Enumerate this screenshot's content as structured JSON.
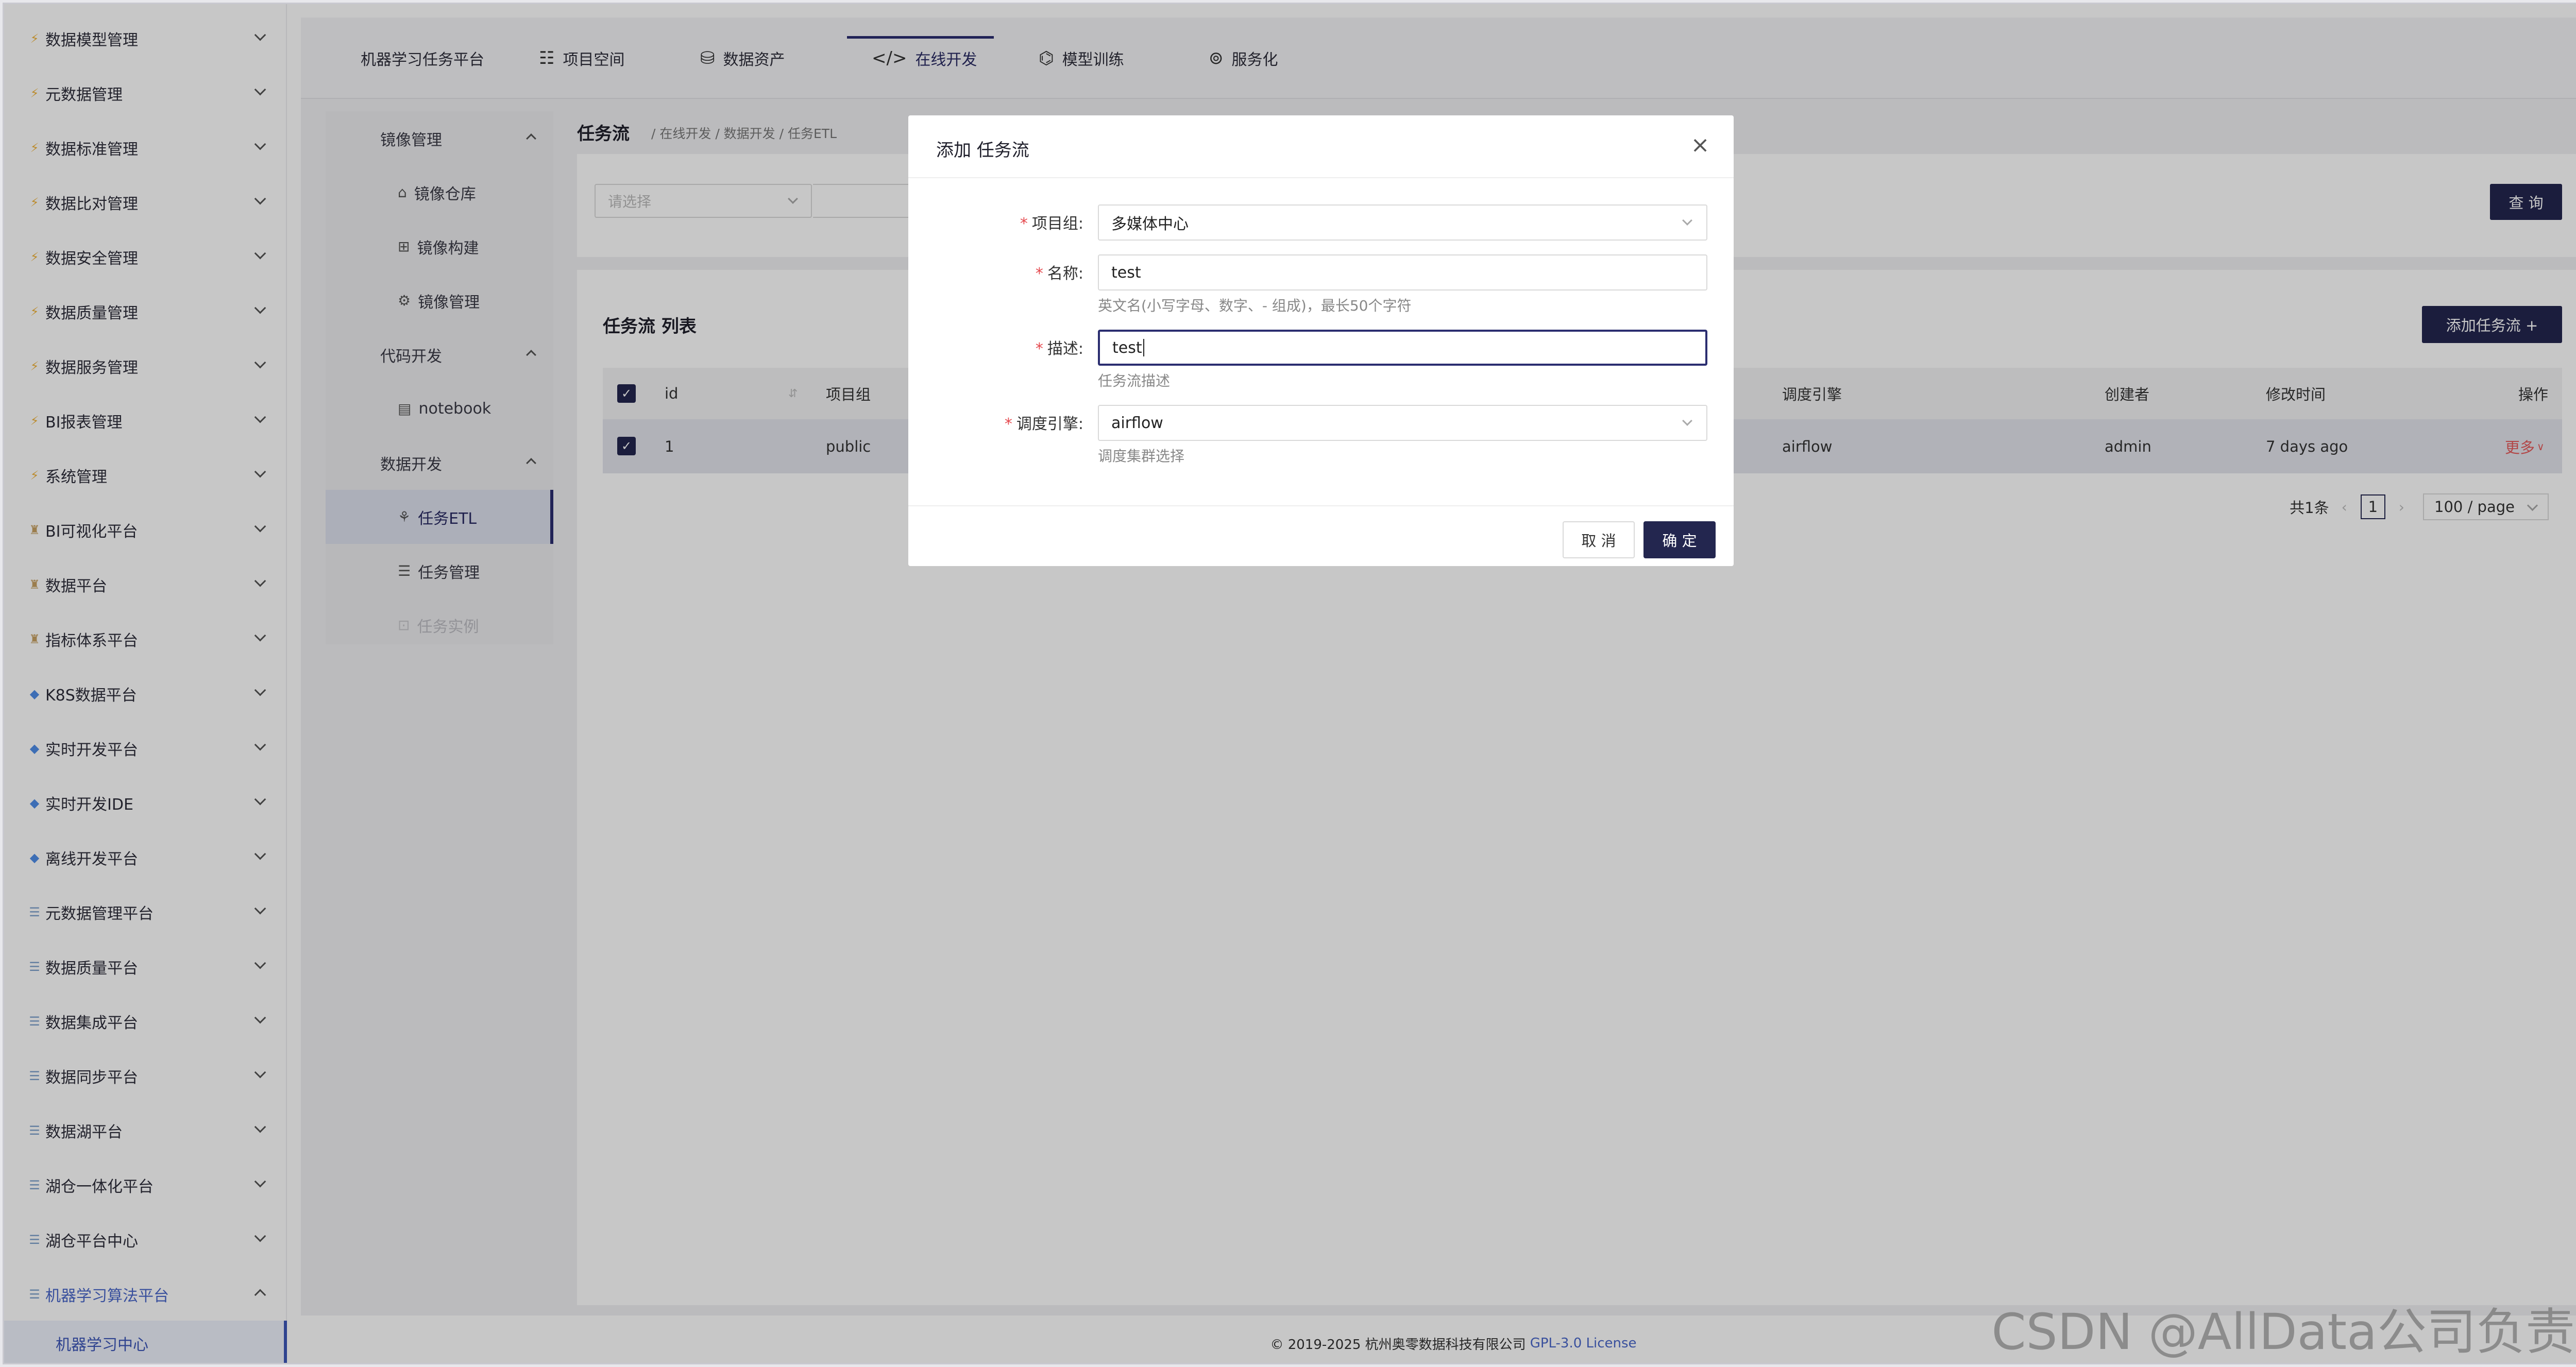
{
  "sidebar": {
    "items": [
      {
        "label": "数据模型管理",
        "icon": "bolt-icon"
      },
      {
        "label": "元数据管理",
        "icon": "bolt-icon"
      },
      {
        "label": "数据标准管理",
        "icon": "bolt-icon"
      },
      {
        "label": "数据比对管理",
        "icon": "bolt-icon"
      },
      {
        "label": "数据安全管理",
        "icon": "bolt-icon"
      },
      {
        "label": "数据质量管理",
        "icon": "bolt-icon"
      },
      {
        "label": "数据服务管理",
        "icon": "bolt-icon"
      },
      {
        "label": "BI报表管理",
        "icon": "bolt-icon"
      },
      {
        "label": "系统管理",
        "icon": "bolt-icon"
      },
      {
        "label": "BI可视化平台",
        "icon": "person-icon"
      },
      {
        "label": "数据平台",
        "icon": "person-icon"
      },
      {
        "label": "指标体系平台",
        "icon": "person-icon"
      },
      {
        "label": "K8S数据平台",
        "icon": "diamond-icon"
      },
      {
        "label": "实时开发平台",
        "icon": "diamond-icon"
      },
      {
        "label": "实时开发IDE",
        "icon": "diamond-icon"
      },
      {
        "label": "离线开发平台",
        "icon": "diamond-icon"
      },
      {
        "label": "元数据管理平台",
        "icon": "stack-icon"
      },
      {
        "label": "数据质量平台",
        "icon": "stack-icon"
      },
      {
        "label": "数据集成平台",
        "icon": "stack-icon"
      },
      {
        "label": "数据同步平台",
        "icon": "stack-icon"
      },
      {
        "label": "数据湖平台",
        "icon": "stack-icon"
      },
      {
        "label": "湖仓一体化平台",
        "icon": "stack-icon"
      },
      {
        "label": "湖仓平台中心",
        "icon": "stack-icon"
      },
      {
        "label": "机器学习算法平台",
        "icon": "stack-icon"
      }
    ],
    "active_sub": "机器学习中心"
  },
  "topnav": {
    "tabs": [
      {
        "label": "机器学习任务平台",
        "icon": ""
      },
      {
        "label": "项目空间",
        "icon": "users-icon"
      },
      {
        "label": "数据资产",
        "icon": "database-icon"
      },
      {
        "label": "在线开发",
        "icon": "code-icon"
      },
      {
        "label": "模型训练",
        "icon": "model-icon"
      },
      {
        "label": "服务化",
        "icon": "service-icon"
      }
    ],
    "active_tab": "在线开发"
  },
  "secmenu": {
    "groups": [
      {
        "label": "镜像管理",
        "items": [
          {
            "label": "镜像仓库",
            "icon": "home-icon"
          },
          {
            "label": "镜像构建",
            "icon": "build-icon"
          },
          {
            "label": "镜像管理",
            "icon": "gear-icon"
          }
        ]
      },
      {
        "label": "代码开发",
        "items": [
          {
            "label": "notebook",
            "icon": "notebook-icon"
          }
        ]
      },
      {
        "label": "数据开发",
        "items": [
          {
            "label": "任务ETL",
            "icon": "etl-icon"
          },
          {
            "label": "任务管理",
            "icon": "list-icon"
          },
          {
            "label": "任务实例",
            "icon": "instance-icon"
          }
        ]
      }
    ]
  },
  "page": {
    "title": "任务流",
    "breadcrumb": "/ 在线开发 / 数据开发 / 任务ETL",
    "filter_placeholder": "请选择",
    "query_label": "查 询",
    "list_title": "任务流 列表",
    "add_label": "添加任务流 +"
  },
  "table": {
    "columns": [
      "id",
      "项目组",
      "调度引擎",
      "创建者",
      "修改时间",
      "操作"
    ],
    "rows": [
      {
        "id": "1",
        "project": "public",
        "engine": "airflow",
        "creator": "admin",
        "modified": "7 days ago",
        "action": "更多"
      }
    ]
  },
  "pager": {
    "total": "共1条",
    "current": "1",
    "page_size": "100 / page"
  },
  "modal": {
    "title": "添加 任务流",
    "fields": {
      "project": {
        "label": "项目组:",
        "value": "多媒体中心"
      },
      "name": {
        "label": "名称:",
        "value": "test",
        "hint": "英文名(小写字母、数字、- 组成)，最长50个字符"
      },
      "desc": {
        "label": "描述:",
        "value": "test",
        "hint": "任务流描述"
      },
      "engine": {
        "label": "调度引擎:",
        "value": "airflow",
        "hint": "调度集群选择"
      }
    },
    "required_mark": "*",
    "cancel_label": "取 消",
    "ok_label": "确 定"
  },
  "footer": {
    "copyright": "© 2019-2025 杭州奥零数据科技有限公司",
    "license": "GPL-3.0 License"
  },
  "watermark": "CSDN @AllData公司负责人",
  "colors": {
    "accent": "#23264f",
    "link": "#4a67c9",
    "danger": "#e45a5a"
  }
}
